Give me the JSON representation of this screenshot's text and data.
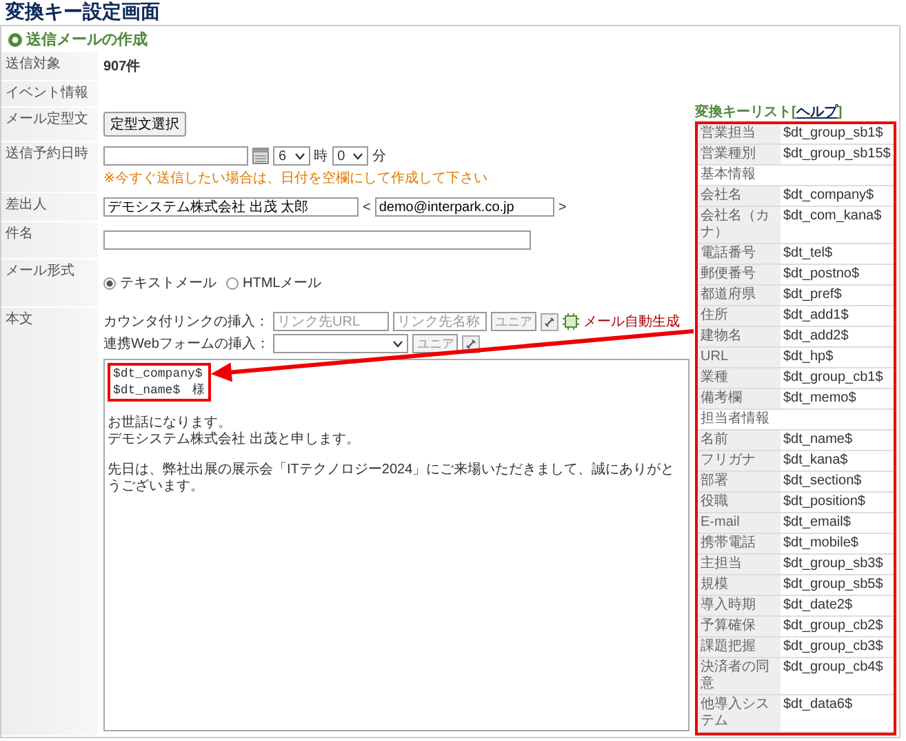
{
  "page_title": "変換キー設定画面",
  "section_title": "送信メールの作成",
  "form": {
    "target": {
      "label": "送信対象",
      "value": "907件"
    },
    "event": {
      "label": "イベント情報"
    },
    "template": {
      "label": "メール定型文",
      "button": "定型文選択"
    },
    "schedule": {
      "label": "送信予約日時",
      "hour": "6",
      "hour_unit": "時",
      "minute": "0",
      "minute_unit": "分",
      "note": "※今すぐ送信したい場合は、日付を空欄にして作成して下さい"
    },
    "sender": {
      "label": "差出人",
      "name": "デモシステム株式会社 出茂 太郎",
      "open": "<",
      "email": "demo@interpark.co.jp",
      "close": ">"
    },
    "subject": {
      "label": "件名"
    },
    "format": {
      "label": "メール形式",
      "options": [
        {
          "label": "テキストメール",
          "selected": true
        },
        {
          "label": "HTMLメール",
          "selected": false
        }
      ]
    },
    "body": {
      "label": "本文",
      "link_label": "カウンタ付リンクの挿入：",
      "url_placeholder": "リンク先URL",
      "name_placeholder": "リンク先名称",
      "insert_button": "ユニア",
      "ai_button": "メール自動生成",
      "form_label": "連携Webフォームの挿入：",
      "form_insert_button": "ユニア",
      "highlighted": [
        "$dt_company$",
        "$dt_name$　様"
      ],
      "paragraphs": [
        [
          "お世話になります。",
          "デモシステム株式会社 出茂と申します。"
        ],
        [
          "先日は、弊社出展の展示会「ITテクノロジー2024」にご来場いただきまして、誠にありがとうございます。"
        ]
      ]
    }
  },
  "key_list": {
    "title": "変換キーリスト[",
    "help_link": "ヘルプ",
    "title_end": "]",
    "rows": [
      {
        "kind": "key",
        "label": "営業担当",
        "key": "$dt_group_sb1$"
      },
      {
        "kind": "key",
        "label": "営業種別",
        "key": "$dt_group_sb15$"
      },
      {
        "kind": "heading",
        "label": "基本情報"
      },
      {
        "kind": "key",
        "label": "会社名",
        "key": "$dt_company$"
      },
      {
        "kind": "key",
        "label": "会社名（カナ）",
        "key": "$dt_com_kana$"
      },
      {
        "kind": "key",
        "label": "電話番号",
        "key": "$dt_tel$"
      },
      {
        "kind": "key",
        "label": "郵便番号",
        "key": "$dt_postno$"
      },
      {
        "kind": "key",
        "label": "都道府県",
        "key": "$dt_pref$"
      },
      {
        "kind": "key",
        "label": "住所",
        "key": "$dt_add1$"
      },
      {
        "kind": "key",
        "label": "建物名",
        "key": "$dt_add2$"
      },
      {
        "kind": "key",
        "label": "URL",
        "key": "$dt_hp$"
      },
      {
        "kind": "key",
        "label": "業種",
        "key": "$dt_group_cb1$"
      },
      {
        "kind": "key",
        "label": "備考欄",
        "key": "$dt_memo$"
      },
      {
        "kind": "heading",
        "label": "担当者情報"
      },
      {
        "kind": "key",
        "label": "名前",
        "key": "$dt_name$"
      },
      {
        "kind": "key",
        "label": "フリガナ",
        "key": "$dt_kana$"
      },
      {
        "kind": "key",
        "label": "部署",
        "key": "$dt_section$"
      },
      {
        "kind": "key",
        "label": "役職",
        "key": "$dt_position$"
      },
      {
        "kind": "key",
        "label": "E-mail",
        "key": "$dt_email$"
      },
      {
        "kind": "key",
        "label": "携帯電話",
        "key": "$dt_mobile$"
      },
      {
        "kind": "key",
        "label": "主担当",
        "key": "$dt_group_sb3$"
      },
      {
        "kind": "key",
        "label": "規模",
        "key": "$dt_group_sb5$"
      },
      {
        "kind": "key",
        "label": "導入時期",
        "key": "$dt_date2$"
      },
      {
        "kind": "key",
        "label": "予算確保",
        "key": "$dt_group_cb2$"
      },
      {
        "kind": "key",
        "label": "課題把握",
        "key": "$dt_group_cb3$"
      },
      {
        "kind": "key",
        "label": "決済者の同意",
        "key": "$dt_group_cb4$"
      },
      {
        "kind": "key",
        "label": "他導入システム",
        "key": "$dt_data6$"
      }
    ]
  }
}
